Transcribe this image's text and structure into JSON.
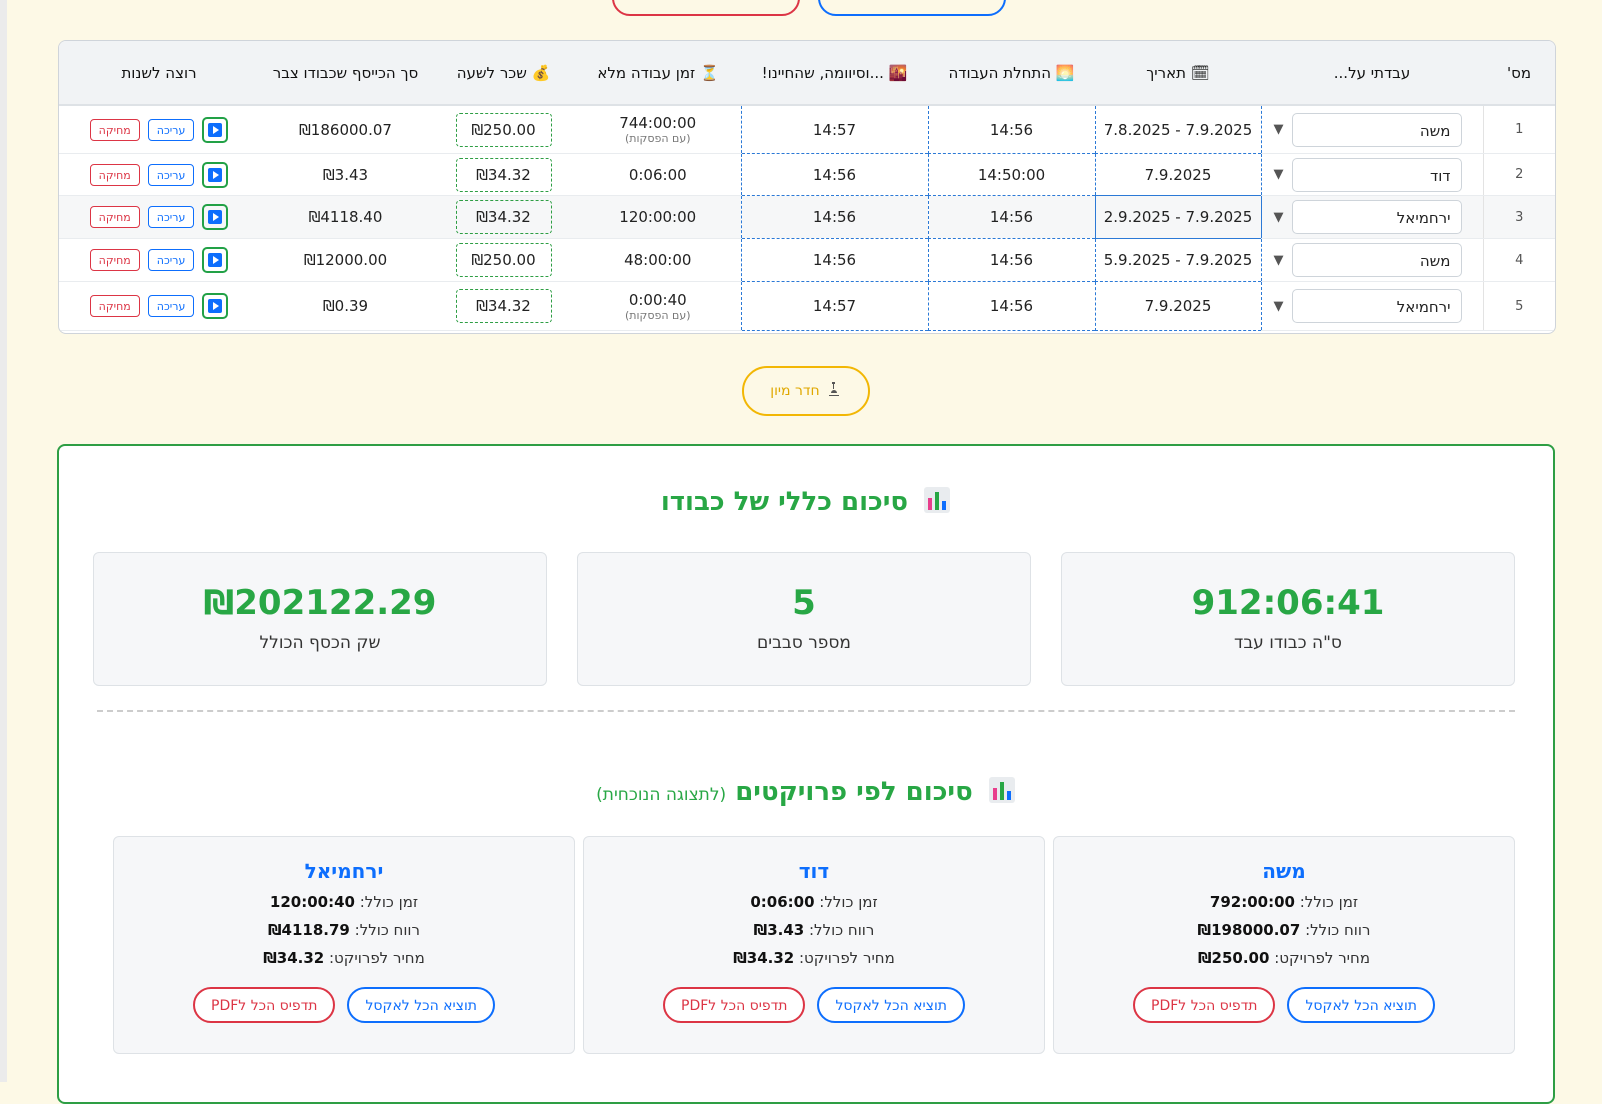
{
  "table": {
    "headers": {
      "num": "מס'",
      "worker": "עבדתי על...",
      "date": "🗓 תאריך",
      "start": "🌅 התחלת העבודה",
      "end": "🌇 ...וסיוומה, שהחיינו!",
      "full_time": "⏳ זמן עבודה מלא",
      "rate": "💰 שכר לשעה",
      "total": "סך הכייסף שכבודו צבר",
      "actions": "רוצה לשנות"
    },
    "rows": [
      {
        "num": "1",
        "worker": "משה",
        "date": "7.9.2025 - 7.8.2025",
        "start": "14:56",
        "end": "14:57",
        "full_time": "744:00:00",
        "full_note": "(עם הפסקות)",
        "rate": "₪250.00",
        "total": "₪186000.07",
        "edit": "עריכה",
        "delete": "מחיקה"
      },
      {
        "num": "2",
        "worker": "דוד",
        "date": "7.9.2025",
        "start": "14:50:00",
        "end": "14:56",
        "full_time": "0:06:00",
        "full_note": "",
        "rate": "₪34.32",
        "total": "₪3.43",
        "edit": "עריכה",
        "delete": "מחיקה"
      },
      {
        "num": "3",
        "worker": "ירחמיאל",
        "date": "7.9.2025 - 2.9.2025",
        "start": "14:56",
        "end": "14:56",
        "full_time": "120:00:00",
        "full_note": "",
        "rate": "₪34.32",
        "total": "₪4118.40",
        "edit": "עריכה",
        "delete": "מחיקה"
      },
      {
        "num": "4",
        "worker": "משה",
        "date": "7.9.2025 - 5.9.2025",
        "start": "14:56",
        "end": "14:56",
        "full_time": "48:00:00",
        "full_note": "",
        "rate": "₪250.00",
        "total": "₪12000.00",
        "edit": "עריכה",
        "delete": "מחיקה"
      },
      {
        "num": "5",
        "worker": "ירחמיאל",
        "date": "7.9.2025",
        "start": "14:56",
        "end": "14:57",
        "full_time": "0:00:40",
        "full_note": "(עם הפסקות)",
        "rate": "₪34.32",
        "total": "₪0.39",
        "edit": "עריכה",
        "delete": "מחיקה"
      }
    ]
  },
  "lab_button": {
    "label": "חדר מיון",
    "icon": "microscope-icon"
  },
  "summary": {
    "title": "סיכום כללי של כבודו",
    "stats": [
      {
        "value": "912:06:41",
        "label": "ס\"ה כבודו עבד"
      },
      {
        "value": "5",
        "label": "מספר סבבים"
      },
      {
        "value": "₪202122.29",
        "label": "שק הכסף הכולל"
      }
    ],
    "projects_title": "סיכום לפי פרויקטים",
    "projects_subtitle": "(לתצוגה הנוכחית)",
    "projects": [
      {
        "name": "משה",
        "time_label": "זמן כולל:",
        "time": "792:00:00",
        "profit_label": "רווח כולל:",
        "profit": "₪198000.07",
        "price_label": "מחיר לפרויקט:",
        "price": "₪250.00",
        "excel": "תוציא הכל לאקסל",
        "pdf": "תדפיס הכל לPDF"
      },
      {
        "name": "דוד",
        "time_label": "זמן כולל:",
        "time": "0:06:00",
        "profit_label": "רווח כולל:",
        "profit": "₪3.43",
        "price_label": "מחיר לפרויקט:",
        "price": "₪34.32",
        "excel": "תוציא הכל לאקסל",
        "pdf": "תדפיס הכל לPDF"
      },
      {
        "name": "ירחמיאל",
        "time_label": "זמן כולל:",
        "time": "120:00:40",
        "profit_label": "רווח כולל:",
        "profit": "₪4118.79",
        "price_label": "מחיר לפרויקט:",
        "price": "₪34.32",
        "excel": "תוציא הכל לאקסל",
        "pdf": "תדפיס הכל לPDF"
      }
    ]
  },
  "colors": {
    "accent_green": "#28a745",
    "accent_blue": "#0d6efd",
    "danger_red": "#dc3545",
    "warning_yellow": "#f2b705",
    "page_bg": "#fdf9e6"
  }
}
